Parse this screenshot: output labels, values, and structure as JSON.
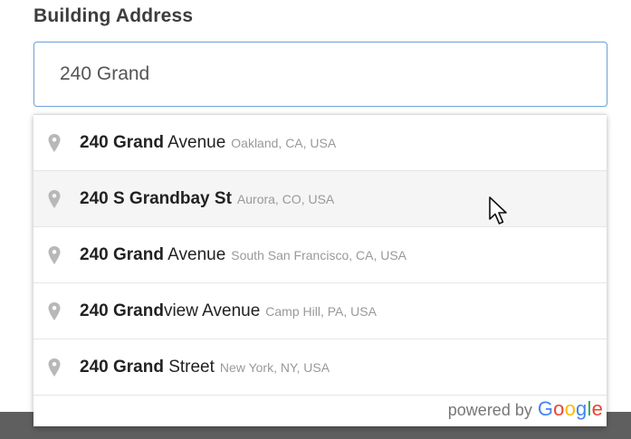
{
  "form": {
    "address_label": "Building Address",
    "address_value": "240 Grand"
  },
  "suggestions": [
    {
      "match": "240 Grand",
      "rest": " Avenue",
      "secondary": "Oakland, CA, USA"
    },
    {
      "match": "240 S Grandbay St",
      "rest": "",
      "secondary": "Aurora, CO, USA"
    },
    {
      "match": "240 Grand",
      "rest": " Avenue",
      "secondary": "South San Francisco, CA, USA"
    },
    {
      "match": "240 Grand",
      "rest": "view Avenue",
      "secondary": "Camp Hill, PA, USA"
    },
    {
      "match": "240 Grand",
      "rest": " Street",
      "secondary": "New York, NY, USA"
    }
  ],
  "attribution": {
    "powered_by": "powered by",
    "google_letters": [
      "G",
      "o",
      "o",
      "g",
      "l",
      "e"
    ]
  },
  "icons": {
    "suggestion_icon": "map-pin-icon",
    "cursor": "mouse-pointer-icon"
  },
  "colors": {
    "input_border": "#72a6d6",
    "hover_row": "#f5f5f5",
    "secondary_text": "#999999"
  }
}
